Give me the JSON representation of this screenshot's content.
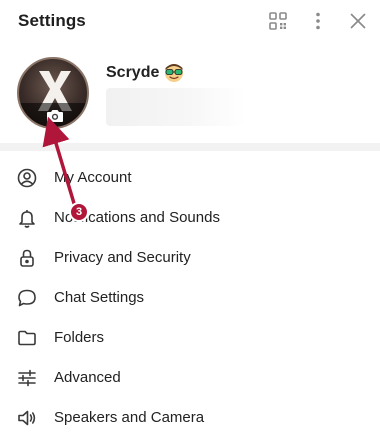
{
  "header": {
    "title": "Settings",
    "icons": [
      "qr-code-icon",
      "more-vertical-icon",
      "close-icon"
    ]
  },
  "profile": {
    "name": "Scryde",
    "avatar_letter": "X",
    "emoji_icon": "nerd-face-emoji"
  },
  "menu": {
    "items": [
      {
        "label": "My Account",
        "icon": "user-circle-icon"
      },
      {
        "label": "Notifications and Sounds",
        "icon": "bell-icon"
      },
      {
        "label": "Privacy and Security",
        "icon": "lock-icon"
      },
      {
        "label": "Chat Settings",
        "icon": "chat-bubble-icon"
      },
      {
        "label": "Folders",
        "icon": "folder-icon"
      },
      {
        "label": "Advanced",
        "icon": "sliders-icon"
      },
      {
        "label": "Speakers and Camera",
        "icon": "speaker-icon"
      }
    ]
  },
  "annotation": {
    "step": "3",
    "color": "#b0163a"
  }
}
